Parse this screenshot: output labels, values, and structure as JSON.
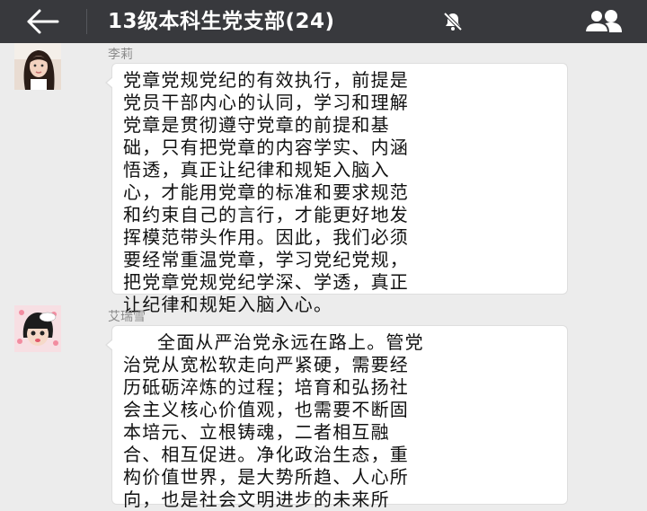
{
  "header": {
    "title": "13级本科生党支部(24)",
    "back_icon": "arrow-left-icon",
    "mute_icon": "bell-muted-icon",
    "members_icon": "group-members-icon",
    "background": "#38393d"
  },
  "messages": [
    {
      "sender": "李莉",
      "avatar": "user-photo-avatar",
      "lines": [
        "党章党规党纪的有效执行，前提是",
        "党员干部内心的认同，学习和理解",
        "党章是贯彻遵守党章的前提和基",
        "础，只有把党章的内容学实、内涵",
        "悟透，真正让纪律和规矩入脑入",
        "心，才能用党章的标准和要求规范",
        "和约束自己的言行，才能更好地发",
        "挥模范带头作用。因此，我们必须",
        "要经常重温党章，学习党纪党规，",
        "把党章党规党纪学深、学透，真正",
        "让纪律和规矩入脑入心。"
      ]
    },
    {
      "sender": "艾瑞雪",
      "avatar": "cartoon-girl-avatar",
      "lines": [
        "全面从严治党永远在路上。管党",
        "治党从宽松软走向严紧硬，需要经",
        "历砥砺淬炼的过程；培育和弘扬社",
        "会主义核心价值观，也需要不断固",
        "本培元、立根铸魂，二者相互融",
        "合、相互促进。净化政治生态，重",
        "构价值世界，是大势所趋、人心所",
        "向，也是社会文明进步的未来所"
      ]
    }
  ]
}
